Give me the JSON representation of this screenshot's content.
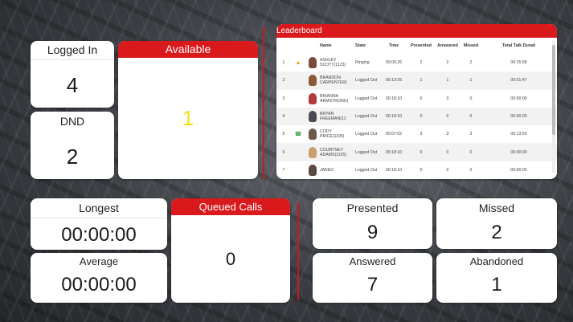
{
  "tiles": {
    "logged_in": {
      "label": "Logged In",
      "value": "4"
    },
    "dnd": {
      "label": "DND",
      "value": "2"
    },
    "available": {
      "label": "Available",
      "value": "1"
    },
    "longest": {
      "label": "Longest",
      "value": "00:00:00"
    },
    "average": {
      "label": "Average",
      "value": "00:00:00"
    },
    "queued": {
      "label": "Queued Calls",
      "value": "0"
    },
    "presented": {
      "label": "Presented",
      "value": "9"
    },
    "missed": {
      "label": "Missed",
      "value": "2"
    },
    "answered": {
      "label": "Answered",
      "value": "7"
    },
    "abandoned": {
      "label": "Abandoned",
      "value": "1"
    }
  },
  "leaderboard": {
    "title": "Leaderboard",
    "columns": [
      "",
      "",
      "",
      "Name",
      "State",
      "Time",
      "Presented",
      "Answered",
      "Missed",
      "Total Talk Durati"
    ],
    "rows": [
      {
        "rank": "1",
        "name1": "ASHLEY",
        "name2": "SCOTT(1123)",
        "state": "Ringing",
        "time": "00:00:26",
        "presented": "2",
        "answered": "2",
        "missed": "2",
        "talk": "00:15:58",
        "status_icon": "ringing-icon",
        "avatar_color": "#7a4a3a"
      },
      {
        "rank": "2",
        "name1": "BRANDON",
        "name2": "CARPENTER(",
        "state": "Logged Out",
        "time": "00:13:26",
        "presented": "1",
        "answered": "1",
        "missed": "1",
        "talk": "00:01:47",
        "status_icon": "",
        "avatar_color": "#8a5a3a"
      },
      {
        "rank": "3",
        "name1": "BRIANNA",
        "name2": "ARMSTRONG(",
        "state": "Logged Out",
        "time": "00:18:10",
        "presented": "0",
        "answered": "0",
        "missed": "0",
        "talk": "00:00:00",
        "status_icon": "",
        "avatar_color": "#b23a3a"
      },
      {
        "rank": "4",
        "name1": "BRYAN",
        "name2": "FREEMAN(11",
        "state": "Logged Out",
        "time": "00:18:10",
        "presented": "0",
        "answered": "0",
        "missed": "0",
        "talk": "00:00:00",
        "status_icon": "",
        "avatar_color": "#4a4a55"
      },
      {
        "rank": "5",
        "name1": "CODY",
        "name2": "PRICE(1195)",
        "state": "Logged Out",
        "time": "00:07:02",
        "presented": "3",
        "answered": "3",
        "missed": "3",
        "talk": "00:13:50",
        "status_icon": "phone-icon",
        "avatar_color": "#6a5a4a"
      },
      {
        "rank": "6",
        "name1": "COURTNEY",
        "name2": "ADAMS(1155)",
        "state": "Logged Out",
        "time": "00:18:10",
        "presented": "0",
        "answered": "0",
        "missed": "0",
        "talk": "00:00:00",
        "status_icon": "",
        "avatar_color": "#c8a070"
      },
      {
        "rank": "7",
        "name1": "JARED",
        "name2": "",
        "state": "Logged Out",
        "time": "00:18:10",
        "presented": "0",
        "answered": "0",
        "missed": "0",
        "talk": "00:00:00",
        "status_icon": "",
        "avatar_color": "#5a4a40"
      }
    ]
  },
  "colors": {
    "accent": "#d9191c",
    "available_value": "#f0e21a",
    "ringing_icon": "#e8a317",
    "phone_icon": "#2e9a3e"
  }
}
